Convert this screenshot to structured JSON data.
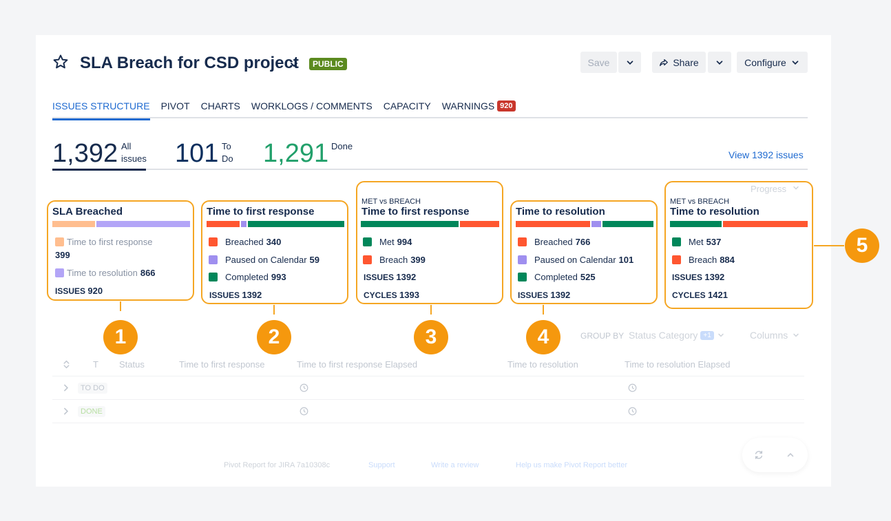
{
  "header": {
    "title": "SLA Breach for CSD project",
    "badge": "PUBLIC",
    "save_label": "Save",
    "share_label": "Share",
    "configure_label": "Configure"
  },
  "tabs": [
    {
      "label": "ISSUES STRUCTURE",
      "active": true
    },
    {
      "label": "PIVOT"
    },
    {
      "label": "CHARTS"
    },
    {
      "label": "WORKLOGS / COMMENTS"
    },
    {
      "label": "CAPACITY"
    },
    {
      "label": "WARNINGS",
      "badge": "920"
    }
  ],
  "summary": {
    "all": {
      "value": "1,392",
      "label1": "All",
      "label2": "issues"
    },
    "todo": {
      "value": "101",
      "label1": "To",
      "label2": "Do"
    },
    "done": {
      "value": "1,291",
      "label1": "Done"
    },
    "view_link": "View 1392 issues"
  },
  "colors": {
    "breach": "#ff5630",
    "paused": "#9f8fef",
    "complete": "#00875a",
    "first_response_light": "#ffbe8f",
    "resolution_light": "#b3a5f7",
    "annotation": "#f5a623",
    "marker": "#f5980e"
  },
  "cards": [
    {
      "title": "SLA Breached",
      "bar": [
        399,
        866
      ],
      "legend": [
        {
          "label": "Time to first response",
          "value": "399"
        },
        {
          "label": "Time to resolution",
          "value": "866"
        }
      ],
      "footer_label": "ISSUES",
      "footer_value": "920",
      "marker": "1"
    },
    {
      "title": "Time to first response",
      "bar": [
        340,
        59,
        993
      ],
      "legend": [
        {
          "label": "Breached",
          "value": "340"
        },
        {
          "label": "Paused on Calendar",
          "value": "59"
        },
        {
          "label": "Completed",
          "value": "993"
        }
      ],
      "footer_label": "ISSUES",
      "footer_value": "1392",
      "marker": "2"
    },
    {
      "subtitle": "MET vs BREACH",
      "title": "Time to first response",
      "bar": [
        994,
        399
      ],
      "legend": [
        {
          "label": "Met",
          "value": "994"
        },
        {
          "label": "Breach",
          "value": "399"
        }
      ],
      "stats": [
        {
          "label": "ISSUES",
          "value": "1392"
        },
        {
          "label": "CYCLES",
          "value": "1393"
        }
      ],
      "marker": "3"
    },
    {
      "title": "Time to resolution",
      "bar": [
        766,
        101,
        525
      ],
      "legend": [
        {
          "label": "Breached",
          "value": "766"
        },
        {
          "label": "Paused on Calendar",
          "value": "101"
        },
        {
          "label": "Completed",
          "value": "525"
        }
      ],
      "footer_label": "ISSUES",
      "footer_value": "1392",
      "marker": "4"
    },
    {
      "subtitle": "MET vs BREACH",
      "title": "Time to resolution",
      "bar": [
        537,
        884
      ],
      "legend": [
        {
          "label": "Met",
          "value": "537"
        },
        {
          "label": "Breach",
          "value": "884"
        }
      ],
      "stats": [
        {
          "label": "ISSUES",
          "value": "1392"
        },
        {
          "label": "CYCLES",
          "value": "1421"
        }
      ],
      "marker": "5"
    }
  ],
  "toolbar": {
    "progress": "Progress",
    "group_by": "GROUP BY",
    "group_value": "Status Category",
    "group_extra": "+1",
    "columns": "Columns"
  },
  "table": {
    "headers": [
      "T",
      "Status",
      "Time to first response",
      "Time to first response Elapsed",
      "Time to resolution",
      "Time to resolution Elapsed"
    ],
    "rows": [
      {
        "status": "TO DO"
      },
      {
        "status": "DONE"
      }
    ]
  },
  "footer": {
    "links": [
      "Pivot Report for JIRA 7a10308c",
      "Support",
      "Write a review",
      "Help us make Pivot Report better"
    ]
  }
}
